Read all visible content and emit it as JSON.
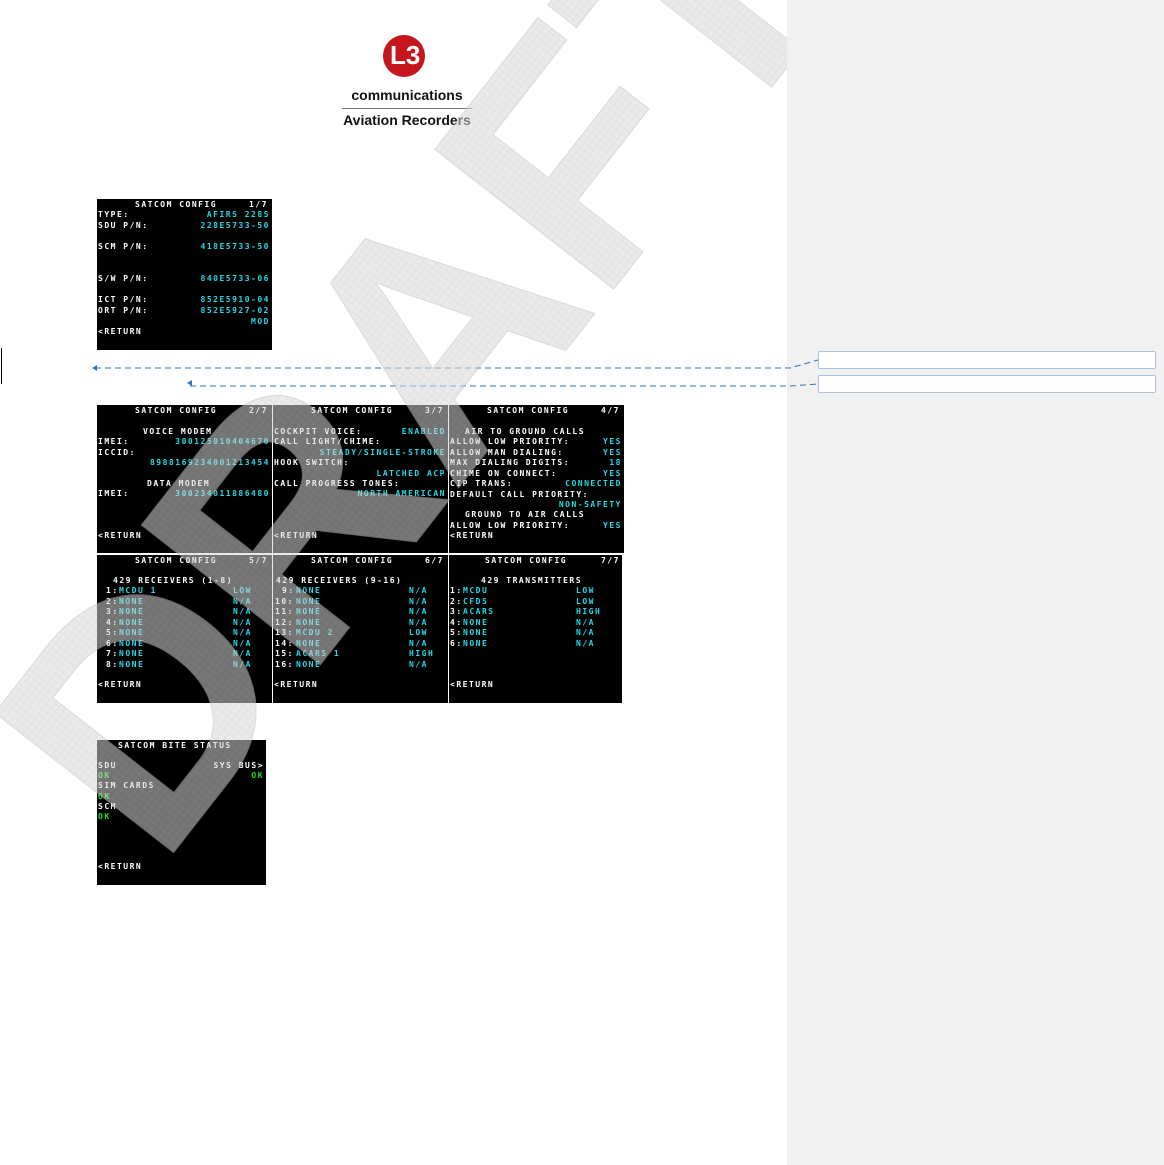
{
  "logo": {
    "mark": "L3",
    "line1": "communications",
    "line2": "Aviation Recorders"
  },
  "colors": {
    "label": "#ffffff",
    "value": "#26d8e6",
    "ok": "#21e021",
    "sidebar": "#f1f1f1",
    "leader": "#2e75b6"
  },
  "screen1": {
    "title": "SATCOM CONFIG",
    "page": "1/7",
    "rows": [
      {
        "label": "TYPE:",
        "value": "AFIRS 228S"
      },
      {
        "label": "SDU P/N:",
        "value": "228E5733-50"
      },
      {
        "label": "SCM P/N:",
        "value": "418E5733-50"
      },
      {
        "label": "S/W P/N:",
        "value": "840E5733-06"
      },
      {
        "label": "ICT P/N:",
        "value": "852E5910-04"
      },
      {
        "label": "ORT P/N:",
        "value": "852E5927-02"
      }
    ],
    "mod": "MOD",
    "return": "<RETURN"
  },
  "screen2": {
    "title": "SATCOM CONFIG",
    "page": "2/7",
    "voice_heading": "VOICE MODEM",
    "imei_label": "IMEI:",
    "imei_value": "300125010404670",
    "iccid_label": "ICCID:",
    "iccid_value": "8988169234001213454",
    "data_heading": "DATA MODEM",
    "imei2_label": "IMEI:",
    "imei2_value": "300234011886480",
    "return": "<RETURN"
  },
  "screen3": {
    "title": "SATCOM CONFIG",
    "page": "3/7",
    "cockpit_label": "COCKPIT VOICE:",
    "cockpit_value": "ENABLED",
    "light_label": "CALL LIGHT/CHIME:",
    "light_value": "STEADY/SINGLE-STROKE",
    "hook_label": "HOOK SWITCH:",
    "hook_value": "LATCHED ACP",
    "tones_label": "CALL PROGRESS TONES:",
    "tones_value": "NORTH AMERICAN",
    "return": "<RETURN"
  },
  "screen4": {
    "title": "SATCOM CONFIG",
    "page": "4/7",
    "heading1": "AIR TO GROUND CALLS",
    "rows": [
      {
        "label": "ALLOW LOW PRIORITY:",
        "value": "YES"
      },
      {
        "label": "ALLOW MAN DIALING:",
        "value": "YES"
      },
      {
        "label": "MAX DIALING DIGITS:",
        "value": "18"
      },
      {
        "label": "CHIME ON CONNECT:",
        "value": "YES"
      },
      {
        "label": "CIP TRANS:",
        "value": "CONNECTED"
      }
    ],
    "default_label": "DEFAULT CALL PRIORITY:",
    "default_value": "NON-SAFETY",
    "heading2": "GROUND TO AIR CALLS",
    "low_label": "ALLOW LOW PRIORITY:",
    "low_value": "YES",
    "return": "<RETURN"
  },
  "screen5": {
    "title": "SATCOM CONFIG",
    "page": "5/7",
    "heading": "429 RECEIVERS (1-8)",
    "rows": [
      {
        "num": "1:",
        "name": "MCDU 1",
        "speed": "LOW"
      },
      {
        "num": "2:",
        "name": "NONE",
        "speed": "N/A"
      },
      {
        "num": "3:",
        "name": "NONE",
        "speed": "N/A"
      },
      {
        "num": "4:",
        "name": "NONE",
        "speed": "N/A"
      },
      {
        "num": "5:",
        "name": "NONE",
        "speed": "N/A"
      },
      {
        "num": "6:",
        "name": "NONE",
        "speed": "N/A"
      },
      {
        "num": "7:",
        "name": "NONE",
        "speed": "N/A"
      },
      {
        "num": "8:",
        "name": "NONE",
        "speed": "N/A"
      }
    ],
    "return": "<RETURN"
  },
  "screen6": {
    "title": "SATCOM CONFIG",
    "page": "6/7",
    "heading": "429 RECEIVERS (9-16)",
    "rows": [
      {
        "num": "9:",
        "name": "NONE",
        "speed": "N/A"
      },
      {
        "num": "10:",
        "name": "NONE",
        "speed": "N/A"
      },
      {
        "num": "11:",
        "name": "NONE",
        "speed": "N/A"
      },
      {
        "num": "12:",
        "name": "NONE",
        "speed": "N/A"
      },
      {
        "num": "13:",
        "name": "MCDU 2",
        "speed": "LOW"
      },
      {
        "num": "14:",
        "name": "NONE",
        "speed": "N/A"
      },
      {
        "num": "15:",
        "name": "ACARS 1",
        "speed": "HIGH"
      },
      {
        "num": "16:",
        "name": "NONE",
        "speed": "N/A"
      }
    ],
    "return": "<RETURN"
  },
  "screen7": {
    "title": "SATCOM CONFIG",
    "page": "7/7",
    "heading": "429 TRANSMITTERS",
    "rows": [
      {
        "num": "1:",
        "name": "MCDU",
        "speed": "LOW"
      },
      {
        "num": "2:",
        "name": "CFDS",
        "speed": "LOW"
      },
      {
        "num": "3:",
        "name": "ACARS",
        "speed": "HIGH"
      },
      {
        "num": "4:",
        "name": "NONE",
        "speed": "N/A"
      },
      {
        "num": "5:",
        "name": "NONE",
        "speed": "N/A"
      },
      {
        "num": "6:",
        "name": "NONE",
        "speed": "N/A"
      }
    ],
    "return": "<RETURN"
  },
  "screen8": {
    "title": "SATCOM BITE STATUS",
    "sdu_label": "SDU",
    "sdu_status": "OK",
    "sysbus_label": "SYS BUS>",
    "sysbus_status": "OK",
    "sim_label": "SIM CARDS",
    "sim_status": "OK",
    "scm_label": "SCM",
    "scm_status": "OK",
    "return": "<RETURN"
  },
  "watermark": "DRAFT"
}
